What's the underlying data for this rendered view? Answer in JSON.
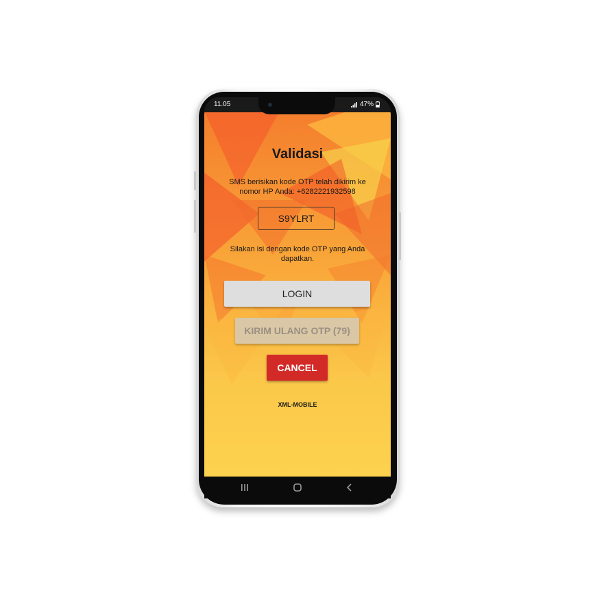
{
  "status_bar": {
    "time": "11.05",
    "battery": "47%"
  },
  "screen": {
    "title": "Validasi",
    "sms_message": "SMS berisikan kode OTP telah dikirim ke nomor HP Anda: +6282221932598",
    "otp_value": "S9YLRT",
    "instruction": "Silakan isi dengan kode OTP yang Anda dapatkan.",
    "login_label": "LOGIN",
    "resend_label": "KIRIM ULANG OTP (79)",
    "cancel_label": "CANCEL",
    "footer_brand": "XML-MOBILE"
  },
  "nav_bar": {
    "icons": [
      "recent-apps-icon",
      "home-icon",
      "back-icon"
    ]
  },
  "colors": {
    "background_primary": "#fbc74a",
    "background_accent": "#f26a2a",
    "cancel_button": "#d22b27",
    "login_button": "#dedede",
    "resend_button_disabled": "#d9c7a6"
  }
}
